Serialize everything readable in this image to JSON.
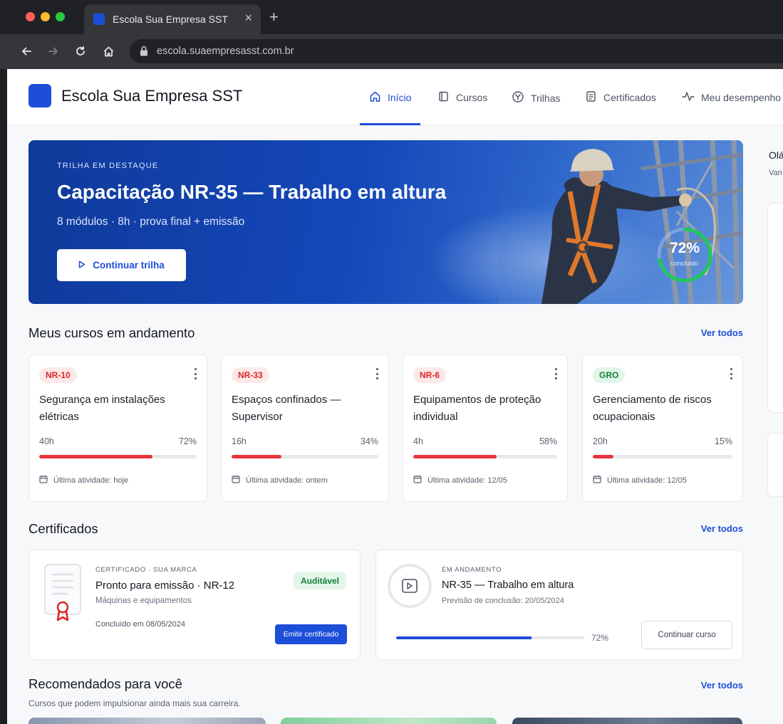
{
  "browser": {
    "tab_title": "Escola Sua Empresa SST",
    "tab_close": "×",
    "new_tab": "+",
    "url": "escola.suaempresasst.com.br"
  },
  "header": {
    "brand": "Escola Sua Empresa SST",
    "nav": [
      {
        "label": "Início",
        "icon": "home-icon",
        "active": true
      },
      {
        "label": "Cursos",
        "icon": "book-icon",
        "active": false
      },
      {
        "label": "Trilhas",
        "icon": "route-icon",
        "active": false
      },
      {
        "label": "Certificados",
        "icon": "document-icon",
        "active": false
      },
      {
        "label": "Meu desempenho",
        "icon": "activity-icon",
        "active": false
      }
    ]
  },
  "hero": {
    "eyebrow": "TRILHA EM DESTAQUE",
    "title": "Capacitação NR-35 — Trabalho em altura",
    "subtitle": "8 módulos · 8h · prova final + emissão",
    "button": "Continuar trilha",
    "progress_label": "72%",
    "progress_value": 0.72,
    "progress_caption": "concluído"
  },
  "courses": {
    "title": "Meus cursos em andamento",
    "see_all": "Ver todos",
    "items": [
      {
        "badge": "NR-10",
        "badge_color": "red",
        "title": "Segurança em instalações elétricas",
        "hours": "40h",
        "pct_label": "72%",
        "progress": 0.72,
        "last": "Última atividade: hoje"
      },
      {
        "badge": "NR-33",
        "badge_color": "red",
        "title": "Espaços confinados — Supervisor",
        "hours": "16h",
        "pct_label": "34%",
        "progress": 0.34,
        "last": "Última atividade: ontem"
      },
      {
        "badge": "NR-6",
        "badge_color": "red",
        "title": "Equipamentos de proteção individual",
        "hours": "4h",
        "pct_label": "58%",
        "progress": 0.58,
        "last": "Última atividade: 12/05"
      },
      {
        "badge": "GRO",
        "badge_color": "green",
        "title": "Gerenciamento de riscos ocupacionais",
        "hours": "20h",
        "pct_label": "15%",
        "progress": 0.15,
        "last": "Última atividade: 12/05"
      }
    ]
  },
  "certificates": {
    "title": "Certificados",
    "see_all": "Ver todos",
    "ready": {
      "eyebrow": "CERTIFICADO · SUA MARCA",
      "title": "Pronto para emissão · NR-12",
      "subtitle": "Máquinas e equipamentos",
      "concluded": "Concluído em 08/05/2024",
      "badge": "Auditável",
      "button": "Emitir certificado"
    },
    "in_progress": {
      "eyebrow": "EM ANDAMENTO",
      "title": "NR-35 — Trabalho em altura",
      "forecast": "Previsão de conclusão: 20/05/2024",
      "pct_label": "72%",
      "progress": 0.72,
      "button": "Continuar curso"
    }
  },
  "recommended": {
    "title": "Recomendados para você",
    "subtitle": "Cursos que podem impulsionar ainda mais sua carreira.",
    "see_all": "Ver todos"
  },
  "sidebar": {
    "greeting": "Olá",
    "sub": "Van"
  },
  "colors": {
    "accent": "#1d4ed8",
    "danger": "#e5343d",
    "success": "#22c55e"
  }
}
